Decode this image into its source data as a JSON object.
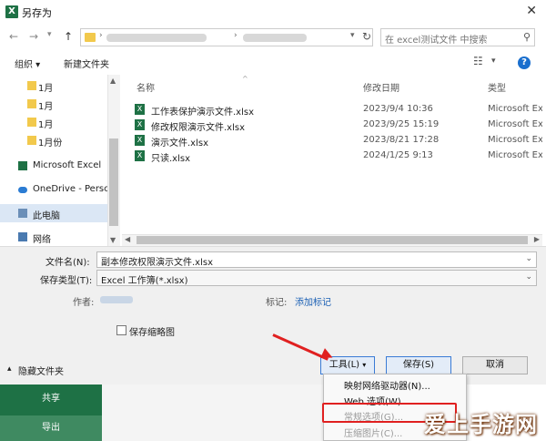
{
  "window": {
    "title": "另存为",
    "icon": "excel-app-icon"
  },
  "address_bar": {
    "path_visible": "›",
    "search_placeholder": "在 excel测试文件 中搜索"
  },
  "toolbar": {
    "organize": "组织 ▾",
    "new_folder": "新建文件夹"
  },
  "nav": {
    "items": [
      {
        "label": "1月",
        "icon": "folder-icon"
      },
      {
        "label": "1月",
        "icon": "folder-icon"
      },
      {
        "label": "1月",
        "icon": "folder-icon"
      },
      {
        "label": "1月份",
        "icon": "folder-icon"
      },
      {
        "label": "Microsoft Excel",
        "icon": "excel-icon"
      },
      {
        "label": "OneDrive - Persc",
        "icon": "onedrive-icon"
      },
      {
        "label": "此电脑",
        "icon": "computer-icon"
      },
      {
        "label": "网络",
        "icon": "network-icon"
      }
    ]
  },
  "files": {
    "columns": {
      "name": "名称",
      "modified": "修改日期",
      "type": "类型"
    },
    "rows": [
      {
        "name": "工作表保护演示文件.xlsx",
        "modified": "2023/9/4 10:36",
        "type": "Microsoft Ex"
      },
      {
        "name": "修改权限演示文件.xlsx",
        "modified": "2023/9/25 15:19",
        "type": "Microsoft Ex"
      },
      {
        "name": "演示文件.xlsx",
        "modified": "2023/8/21 17:28",
        "type": "Microsoft Ex"
      },
      {
        "name": "只读.xlsx",
        "modified": "2024/1/25 9:13",
        "type": "Microsoft Ex"
      }
    ]
  },
  "form": {
    "filename_label": "文件名(N):",
    "filename_value": "副本修改权限演示文件.xlsx",
    "filetype_label": "保存类型(T):",
    "filetype_value": "Excel 工作簿(*.xlsx)",
    "author_label": "作者:",
    "tags_label": "标记:",
    "tags_link": "添加标记",
    "thumbnail_label": "保存缩略图"
  },
  "bottom": {
    "hide_folders": "隐藏文件夹",
    "tools": "工具(L)",
    "save": "保存(S)",
    "cancel": "取消"
  },
  "tools_menu": {
    "items": [
      {
        "label": "映射网络驱动器(N)...",
        "enabled": true
      },
      {
        "label": "Web 选项(W)...",
        "enabled": true
      },
      {
        "label": "常规选项(G)...",
        "enabled": false
      },
      {
        "label": "压缩图片(C)...",
        "enabled": false
      }
    ]
  },
  "backstage": {
    "share": "共享",
    "export": "导出"
  },
  "watermark": "爱上手游网",
  "colors": {
    "excel_green": "#1e7145",
    "highlight_red": "#e02020",
    "accent_blue": "#3a7bd5"
  }
}
